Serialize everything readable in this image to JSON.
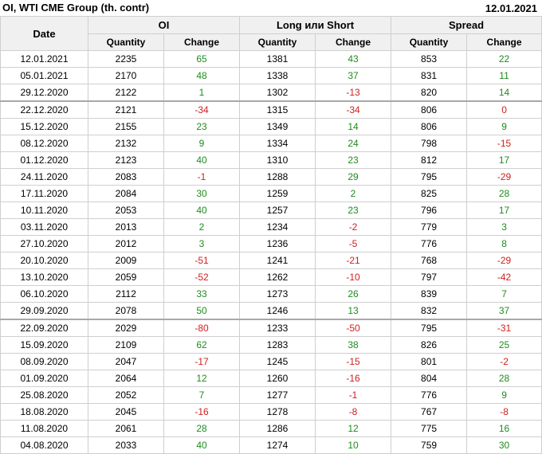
{
  "header": {
    "title": "OI, WTI CME Group (th. contr)",
    "date": "12.01.2021"
  },
  "columns": {
    "date": "Date",
    "groups": [
      "OI",
      "Long или Short",
      "Spread"
    ],
    "sub": [
      "Quantity",
      "Change"
    ]
  },
  "rows": [
    {
      "date": "12.01.2021",
      "oi_q": "2235",
      "oi_c": "65",
      "ls_q": "1381",
      "ls_c": "43",
      "sp_q": "853",
      "sp_c": "22"
    },
    {
      "date": "05.01.2021",
      "oi_q": "2170",
      "oi_c": "48",
      "ls_q": "1338",
      "ls_c": "37",
      "sp_q": "831",
      "sp_c": "11"
    },
    {
      "date": "29.12.2020",
      "oi_q": "2122",
      "oi_c": "1",
      "ls_q": "1302",
      "ls_c": "-13",
      "sp_q": "820",
      "sp_c": "14"
    },
    {
      "date": "22.12.2020",
      "oi_q": "2121",
      "oi_c": "-34",
      "ls_q": "1315",
      "ls_c": "-34",
      "sp_q": "806",
      "sp_c": "0"
    },
    {
      "date": "15.12.2020",
      "oi_q": "2155",
      "oi_c": "23",
      "ls_q": "1349",
      "ls_c": "14",
      "sp_q": "806",
      "sp_c": "9"
    },
    {
      "date": "08.12.2020",
      "oi_q": "2132",
      "oi_c": "9",
      "ls_q": "1334",
      "ls_c": "24",
      "sp_q": "798",
      "sp_c": "-15"
    },
    {
      "date": "01.12.2020",
      "oi_q": "2123",
      "oi_c": "40",
      "ls_q": "1310",
      "ls_c": "23",
      "sp_q": "812",
      "sp_c": "17"
    },
    {
      "date": "24.11.2020",
      "oi_q": "2083",
      "oi_c": "-1",
      "ls_q": "1288",
      "ls_c": "29",
      "sp_q": "795",
      "sp_c": "-29"
    },
    {
      "date": "17.11.2020",
      "oi_q": "2084",
      "oi_c": "30",
      "ls_q": "1259",
      "ls_c": "2",
      "sp_q": "825",
      "sp_c": "28"
    },
    {
      "date": "10.11.2020",
      "oi_q": "2053",
      "oi_c": "40",
      "ls_q": "1257",
      "ls_c": "23",
      "sp_q": "796",
      "sp_c": "17"
    },
    {
      "date": "03.11.2020",
      "oi_q": "2013",
      "oi_c": "2",
      "ls_q": "1234",
      "ls_c": "-2",
      "sp_q": "779",
      "sp_c": "3"
    },
    {
      "date": "27.10.2020",
      "oi_q": "2012",
      "oi_c": "3",
      "ls_q": "1236",
      "ls_c": "-5",
      "sp_q": "776",
      "sp_c": "8"
    },
    {
      "date": "20.10.2020",
      "oi_q": "2009",
      "oi_c": "-51",
      "ls_q": "1241",
      "ls_c": "-21",
      "sp_q": "768",
      "sp_c": "-29"
    },
    {
      "date": "13.10.2020",
      "oi_q": "2059",
      "oi_c": "-52",
      "ls_q": "1262",
      "ls_c": "-10",
      "sp_q": "797",
      "sp_c": "-42"
    },
    {
      "date": "06.10.2020",
      "oi_q": "2112",
      "oi_c": "33",
      "ls_q": "1273",
      "ls_c": "26",
      "sp_q": "839",
      "sp_c": "7"
    },
    {
      "date": "29.09.2020",
      "oi_q": "2078",
      "oi_c": "50",
      "ls_q": "1246",
      "ls_c": "13",
      "sp_q": "832",
      "sp_c": "37"
    },
    {
      "date": "22.09.2020",
      "oi_q": "2029",
      "oi_c": "-80",
      "ls_q": "1233",
      "ls_c": "-50",
      "sp_q": "795",
      "sp_c": "-31"
    },
    {
      "date": "15.09.2020",
      "oi_q": "2109",
      "oi_c": "62",
      "ls_q": "1283",
      "ls_c": "38",
      "sp_q": "826",
      "sp_c": "25"
    },
    {
      "date": "08.09.2020",
      "oi_q": "2047",
      "oi_c": "-17",
      "ls_q": "1245",
      "ls_c": "-15",
      "sp_q": "801",
      "sp_c": "-2"
    },
    {
      "date": "01.09.2020",
      "oi_q": "2064",
      "oi_c": "12",
      "ls_q": "1260",
      "ls_c": "-16",
      "sp_q": "804",
      "sp_c": "28"
    },
    {
      "date": "25.08.2020",
      "oi_q": "2052",
      "oi_c": "7",
      "ls_q": "1277",
      "ls_c": "-1",
      "sp_q": "776",
      "sp_c": "9"
    },
    {
      "date": "18.08.2020",
      "oi_q": "2045",
      "oi_c": "-16",
      "ls_q": "1278",
      "ls_c": "-8",
      "sp_q": "767",
      "sp_c": "-8"
    },
    {
      "date": "11.08.2020",
      "oi_q": "2061",
      "oi_c": "28",
      "ls_q": "1286",
      "ls_c": "12",
      "sp_q": "775",
      "sp_c": "16"
    },
    {
      "date": "04.08.2020",
      "oi_q": "2033",
      "oi_c": "40",
      "ls_q": "1274",
      "ls_c": "10",
      "sp_q": "759",
      "sp_c": "30"
    }
  ],
  "colors": {
    "positive": "#1e8c1e",
    "negative": "#d21e1e",
    "header_bg": "#f0f0f0",
    "grid": "#cfcfcf"
  }
}
